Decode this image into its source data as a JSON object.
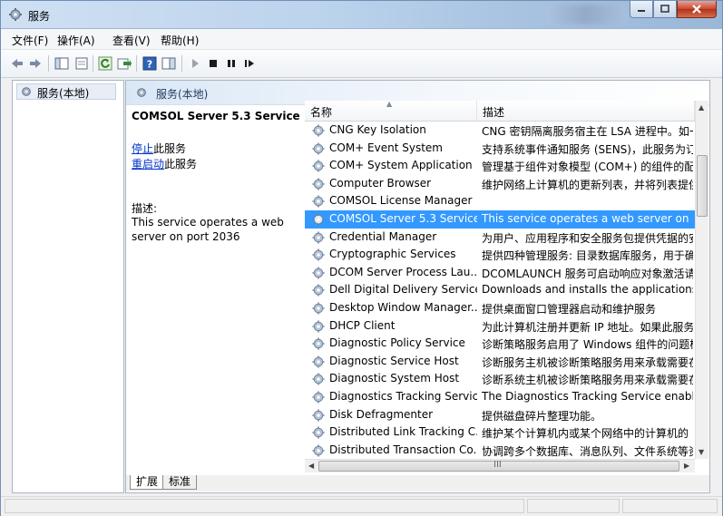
{
  "window": {
    "title": "服务",
    "icon": "services-gear-icon"
  },
  "menu": [
    {
      "label": "文件(F)"
    },
    {
      "label": "操作(A)"
    },
    {
      "label": "查看(V)"
    },
    {
      "label": "帮助(H)"
    }
  ],
  "toolbar": {
    "icons": [
      "back-arrow-icon",
      "forward-arrow-icon",
      "console-tree-icon",
      "properties-icon",
      "refresh-icon",
      "export-list-icon",
      "help-icon",
      "show-hide-icon",
      "start-service-icon",
      "stop-service-icon",
      "pause-service-icon",
      "restart-service-icon"
    ]
  },
  "tree": {
    "item_label": "服务(本地)"
  },
  "pane": {
    "header_label": "服务(本地)",
    "selected_service_title": "COMSOL Server 5.3 Service",
    "stop_link": "停止",
    "stop_suffix": "此服务",
    "restart_link": "重启动",
    "restart_suffix": "此服务",
    "description_label": "描述:",
    "description_text": "This service operates a web server on port 2036"
  },
  "list": {
    "col_name": "名称",
    "col_desc": "描述",
    "rows": [
      {
        "name": "CNG Key Isolation",
        "desc": "CNG 密钥隔离服务宿主在 LSA 进程中。如一..."
      },
      {
        "name": "COM+ Event System",
        "desc": "支持系统事件通知服务 (SENS)，此服务为订..."
      },
      {
        "name": "COM+ System Application",
        "desc": "管理基于组件对象模型 (COM+) 的组件的配..."
      },
      {
        "name": "Computer Browser",
        "desc": "维护网络上计算机的更新列表，并将列表提供..."
      },
      {
        "name": "COMSOL License Manager",
        "desc": ""
      },
      {
        "name": "COMSOL Server 5.3 Service",
        "desc": "This service operates a web server on po...",
        "selected": true
      },
      {
        "name": "Credential Manager",
        "desc": "为用户、应用程序和安全服务包提供凭据的安..."
      },
      {
        "name": "Cryptographic Services",
        "desc": "提供四种管理服务: 目录数据库服务，用于确..."
      },
      {
        "name": "DCOM Server Process Lau...",
        "desc": "DCOMLAUNCH 服务可启动响应对象激活请..."
      },
      {
        "name": "Dell Digital Delivery Service",
        "desc": "Downloads and installs the applications th..."
      },
      {
        "name": "Desktop Window Manager...",
        "desc": "提供桌面窗口管理器启动和维护服务"
      },
      {
        "name": "DHCP Client",
        "desc": "为此计算机注册并更新 IP 地址。如果此服务..."
      },
      {
        "name": "Diagnostic Policy Service",
        "desc": "诊断策略服务启用了 Windows 组件的问题检..."
      },
      {
        "name": "Diagnostic Service Host",
        "desc": "诊断服务主机被诊断策略服务用来承载需要在..."
      },
      {
        "name": "Diagnostic System Host",
        "desc": "诊断系统主机被诊断策略服务用来承载需要在..."
      },
      {
        "name": "Diagnostics Tracking Service",
        "desc": "The Diagnostics Tracking Service enables ..."
      },
      {
        "name": "Disk Defragmenter",
        "desc": "提供磁盘碎片整理功能。"
      },
      {
        "name": "Distributed Link Tracking C...",
        "desc": "维护某个计算机内或某个网络中的计算机的 N..."
      },
      {
        "name": "Distributed Transaction Co...",
        "desc": "协调跨多个数据库、消息队列、文件系统等资..."
      }
    ],
    "hscroll_grip": "III"
  },
  "tabs": [
    {
      "label": "扩展",
      "active": true
    },
    {
      "label": "标准",
      "active": false
    }
  ]
}
